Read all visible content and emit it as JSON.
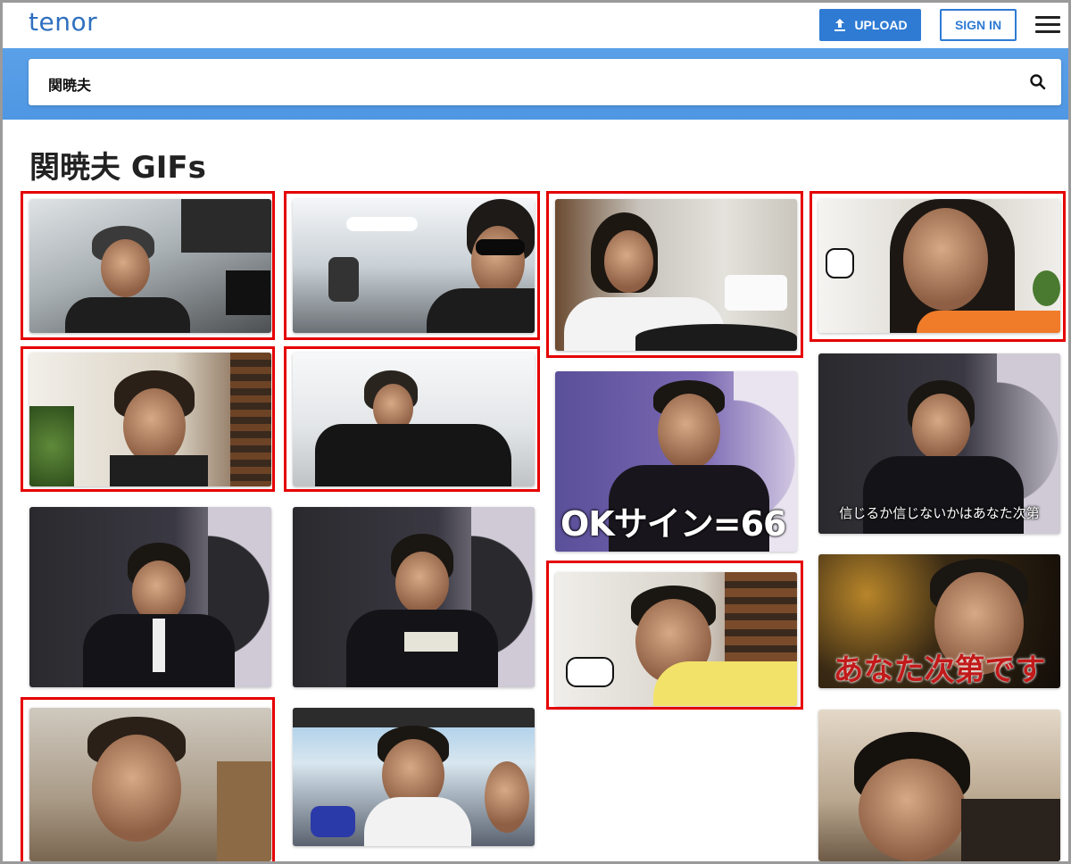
{
  "header": {
    "logo": "tenor",
    "upload_label": "UPLOAD",
    "signin_label": "SIGN IN"
  },
  "search": {
    "query": "関暁夫"
  },
  "page": {
    "title": "関暁夫 GIFs"
  },
  "gifs": [
    {
      "id": "gif-1",
      "caption": ""
    },
    {
      "id": "gif-2",
      "caption": ""
    },
    {
      "id": "gif-3",
      "caption": ""
    },
    {
      "id": "gif-4",
      "caption": ""
    },
    {
      "id": "gif-5",
      "caption": ""
    },
    {
      "id": "gif-6",
      "caption": ""
    },
    {
      "id": "gif-7",
      "caption": "OKサイン=66"
    },
    {
      "id": "gif-8",
      "caption": "信じるか信じないかはあなた次第"
    },
    {
      "id": "gif-9",
      "caption": ""
    },
    {
      "id": "gif-10",
      "caption": ""
    },
    {
      "id": "gif-11",
      "caption": ""
    },
    {
      "id": "gif-12",
      "caption": "あなた次第です"
    },
    {
      "id": "gif-13",
      "caption": ""
    },
    {
      "id": "gif-14",
      "caption": ""
    },
    {
      "id": "gif-15",
      "caption": ""
    }
  ],
  "colors": {
    "brand": "#2f6fbf",
    "accent": "#2f7bd4",
    "search_band": "#4f97e3",
    "highlight": "#e50000"
  }
}
